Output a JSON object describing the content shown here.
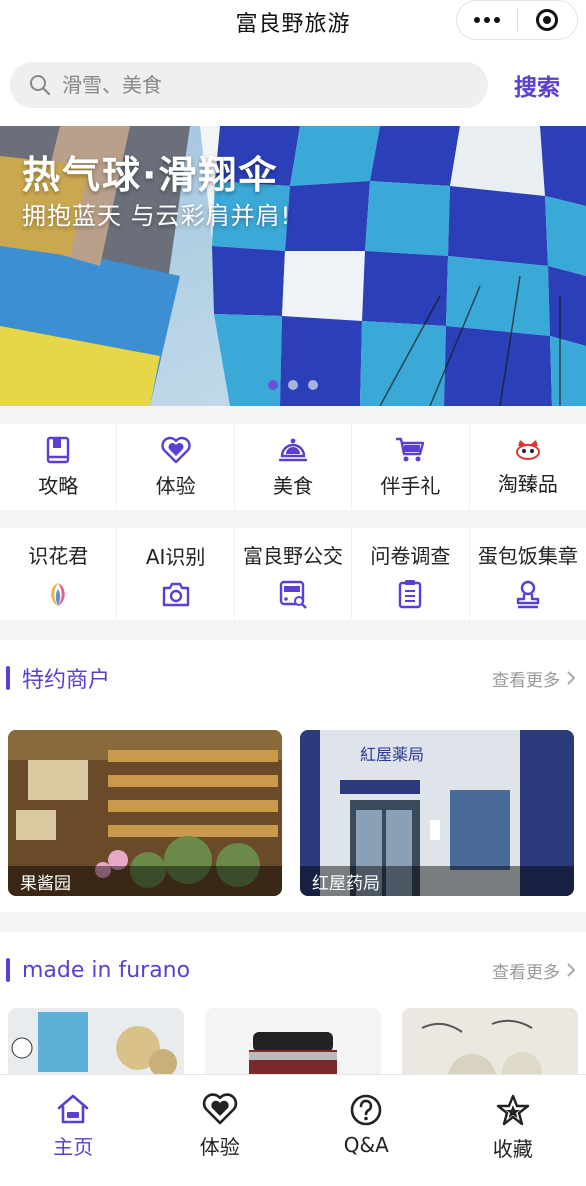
{
  "app": {
    "title": "富良野旅游"
  },
  "search": {
    "placeholder": "滑雪、美食",
    "button_label": "搜索"
  },
  "banner": {
    "headline": "热气球·滑翔伞",
    "subline": "拥抱蓝天 与云彩肩并肩!",
    "slide_count": 3,
    "active_slide": 1
  },
  "quick_nav": [
    {
      "label": "攻略",
      "icon": "book-icon"
    },
    {
      "label": "体验",
      "icon": "heart-icon"
    },
    {
      "label": "美食",
      "icon": "cloche-icon"
    },
    {
      "label": "伴手礼",
      "icon": "cart-icon"
    },
    {
      "label": "淘臻品",
      "icon": "cat-face-icon"
    }
  ],
  "tools": [
    {
      "label": "识花君",
      "icon": "petal-logo-icon"
    },
    {
      "label": "AI识别",
      "icon": "camera-icon"
    },
    {
      "label": "富良野公交",
      "icon": "bus-search-icon"
    },
    {
      "label": "问卷调查",
      "icon": "clipboard-icon"
    },
    {
      "label": "蛋包饭集章",
      "icon": "stamp-icon"
    }
  ],
  "featured": {
    "title": "特约商户",
    "more": "查看更多",
    "items": [
      {
        "name": "果酱园"
      },
      {
        "name": "红屋药局"
      }
    ]
  },
  "made_in": {
    "title": "made in furano",
    "more": "查看更多"
  },
  "tabbar": [
    {
      "label": "主页",
      "icon": "home-icon",
      "active": true
    },
    {
      "label": "体验",
      "icon": "heart-icon",
      "active": false
    },
    {
      "label": "Q&A",
      "icon": "question-icon",
      "active": false
    },
    {
      "label": "收藏",
      "icon": "star-icon",
      "active": false
    }
  ],
  "colors": {
    "accent": "#5b3fd0",
    "background": "#f4f4f6"
  }
}
